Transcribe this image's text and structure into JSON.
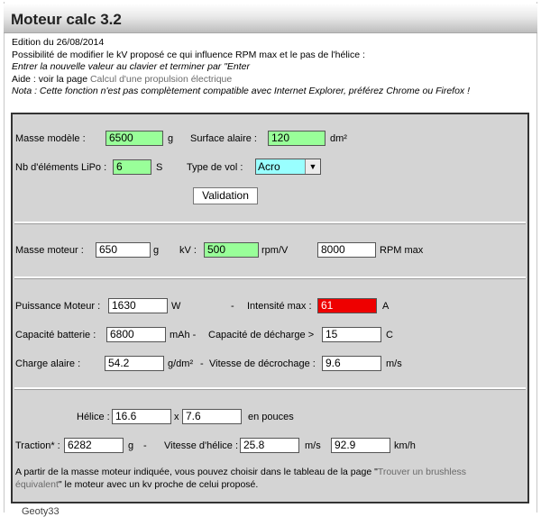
{
  "header": {
    "title": "Moteur calc 3.2"
  },
  "intro": {
    "edition": "Edition du 26/08/2014",
    "possibility": "Possibilité de modifier le kV proposé ce qui influence RPM max et le pas de l'hélice :",
    "entry_hint": "Entrer la nouvelle valeur au clavier et terminer par \"Enter",
    "help_prefix": "Aide : voir la page ",
    "help_link": "Calcul d'une propulsion électrique",
    "note": "Nota : Cette fonction n'est pas complètement compatible avec Internet Explorer, préférez Chrome ou Firefox  !"
  },
  "model": {
    "mass_label": "Masse modèle :",
    "mass_value": "6500",
    "mass_unit": "g",
    "wing_area_label": "Surface alaire :",
    "wing_area_value": "120",
    "wing_area_unit": "dm²",
    "lipo_label": "Nb d'éléments LiPo :",
    "lipo_value": "6",
    "lipo_unit": "S",
    "flight_type_label": "Type de vol :",
    "flight_type_value": "Acro",
    "validate_label": "Validation"
  },
  "motor": {
    "mass_label": "Masse moteur :",
    "mass_value": "650",
    "mass_unit": "g",
    "kv_label": "kV :",
    "kv_value": "500",
    "kv_unit": "rpm/V",
    "rpm_value": "8000",
    "rpm_unit": "RPM max"
  },
  "power": {
    "power_label": "Puissance Moteur :",
    "power_value": "1630",
    "power_unit": "W",
    "sep1": "-",
    "current_label": "Intensité max :",
    "current_value": "61",
    "current_unit": "A",
    "battery_label": "Capacité batterie :",
    "battery_value": "6800",
    "battery_unit": "mAh -",
    "discharge_label": "Capacité de décharge >",
    "discharge_value": "15",
    "discharge_unit": "C",
    "wing_load_label": "Charge alaire :",
    "wing_load_value": "54.2",
    "wing_load_unit": "g/dm²",
    "sep2": "-",
    "stall_label": "Vitesse de décrochage :",
    "stall_value": "9.6",
    "stall_unit": "m/s"
  },
  "propeller": {
    "prop_label": "Hélice :",
    "diameter_value": "16.6",
    "x_sep": "x",
    "pitch_value": "7.6",
    "prop_unit": "en  pouces",
    "traction_label": "Traction* :",
    "traction_value": "6282",
    "traction_unit": "g",
    "sep": "-",
    "speed_label": "Vitesse d'hélice :",
    "speed_value": "25.8",
    "speed_unit": "m/s",
    "speed_kmh_value": "92.9",
    "speed_kmh_unit": "km/h"
  },
  "info": {
    "text_prefix": "A partir de la masse moteur indiquée, vous pouvez choisir dans le tableau de la page \"",
    "text_link_1": "Trouver un brushless",
    "text_link_2": "équivalent",
    "text_suffix": "\" le moteur avec un kv proche de celui proposé."
  },
  "footer": {
    "text": "Geoty33"
  },
  "colors": {
    "input_green": "#99ff99",
    "input_red": "#ee0000",
    "select_cyan": "#99ffff",
    "panel_gray": "#d4d4d4"
  }
}
